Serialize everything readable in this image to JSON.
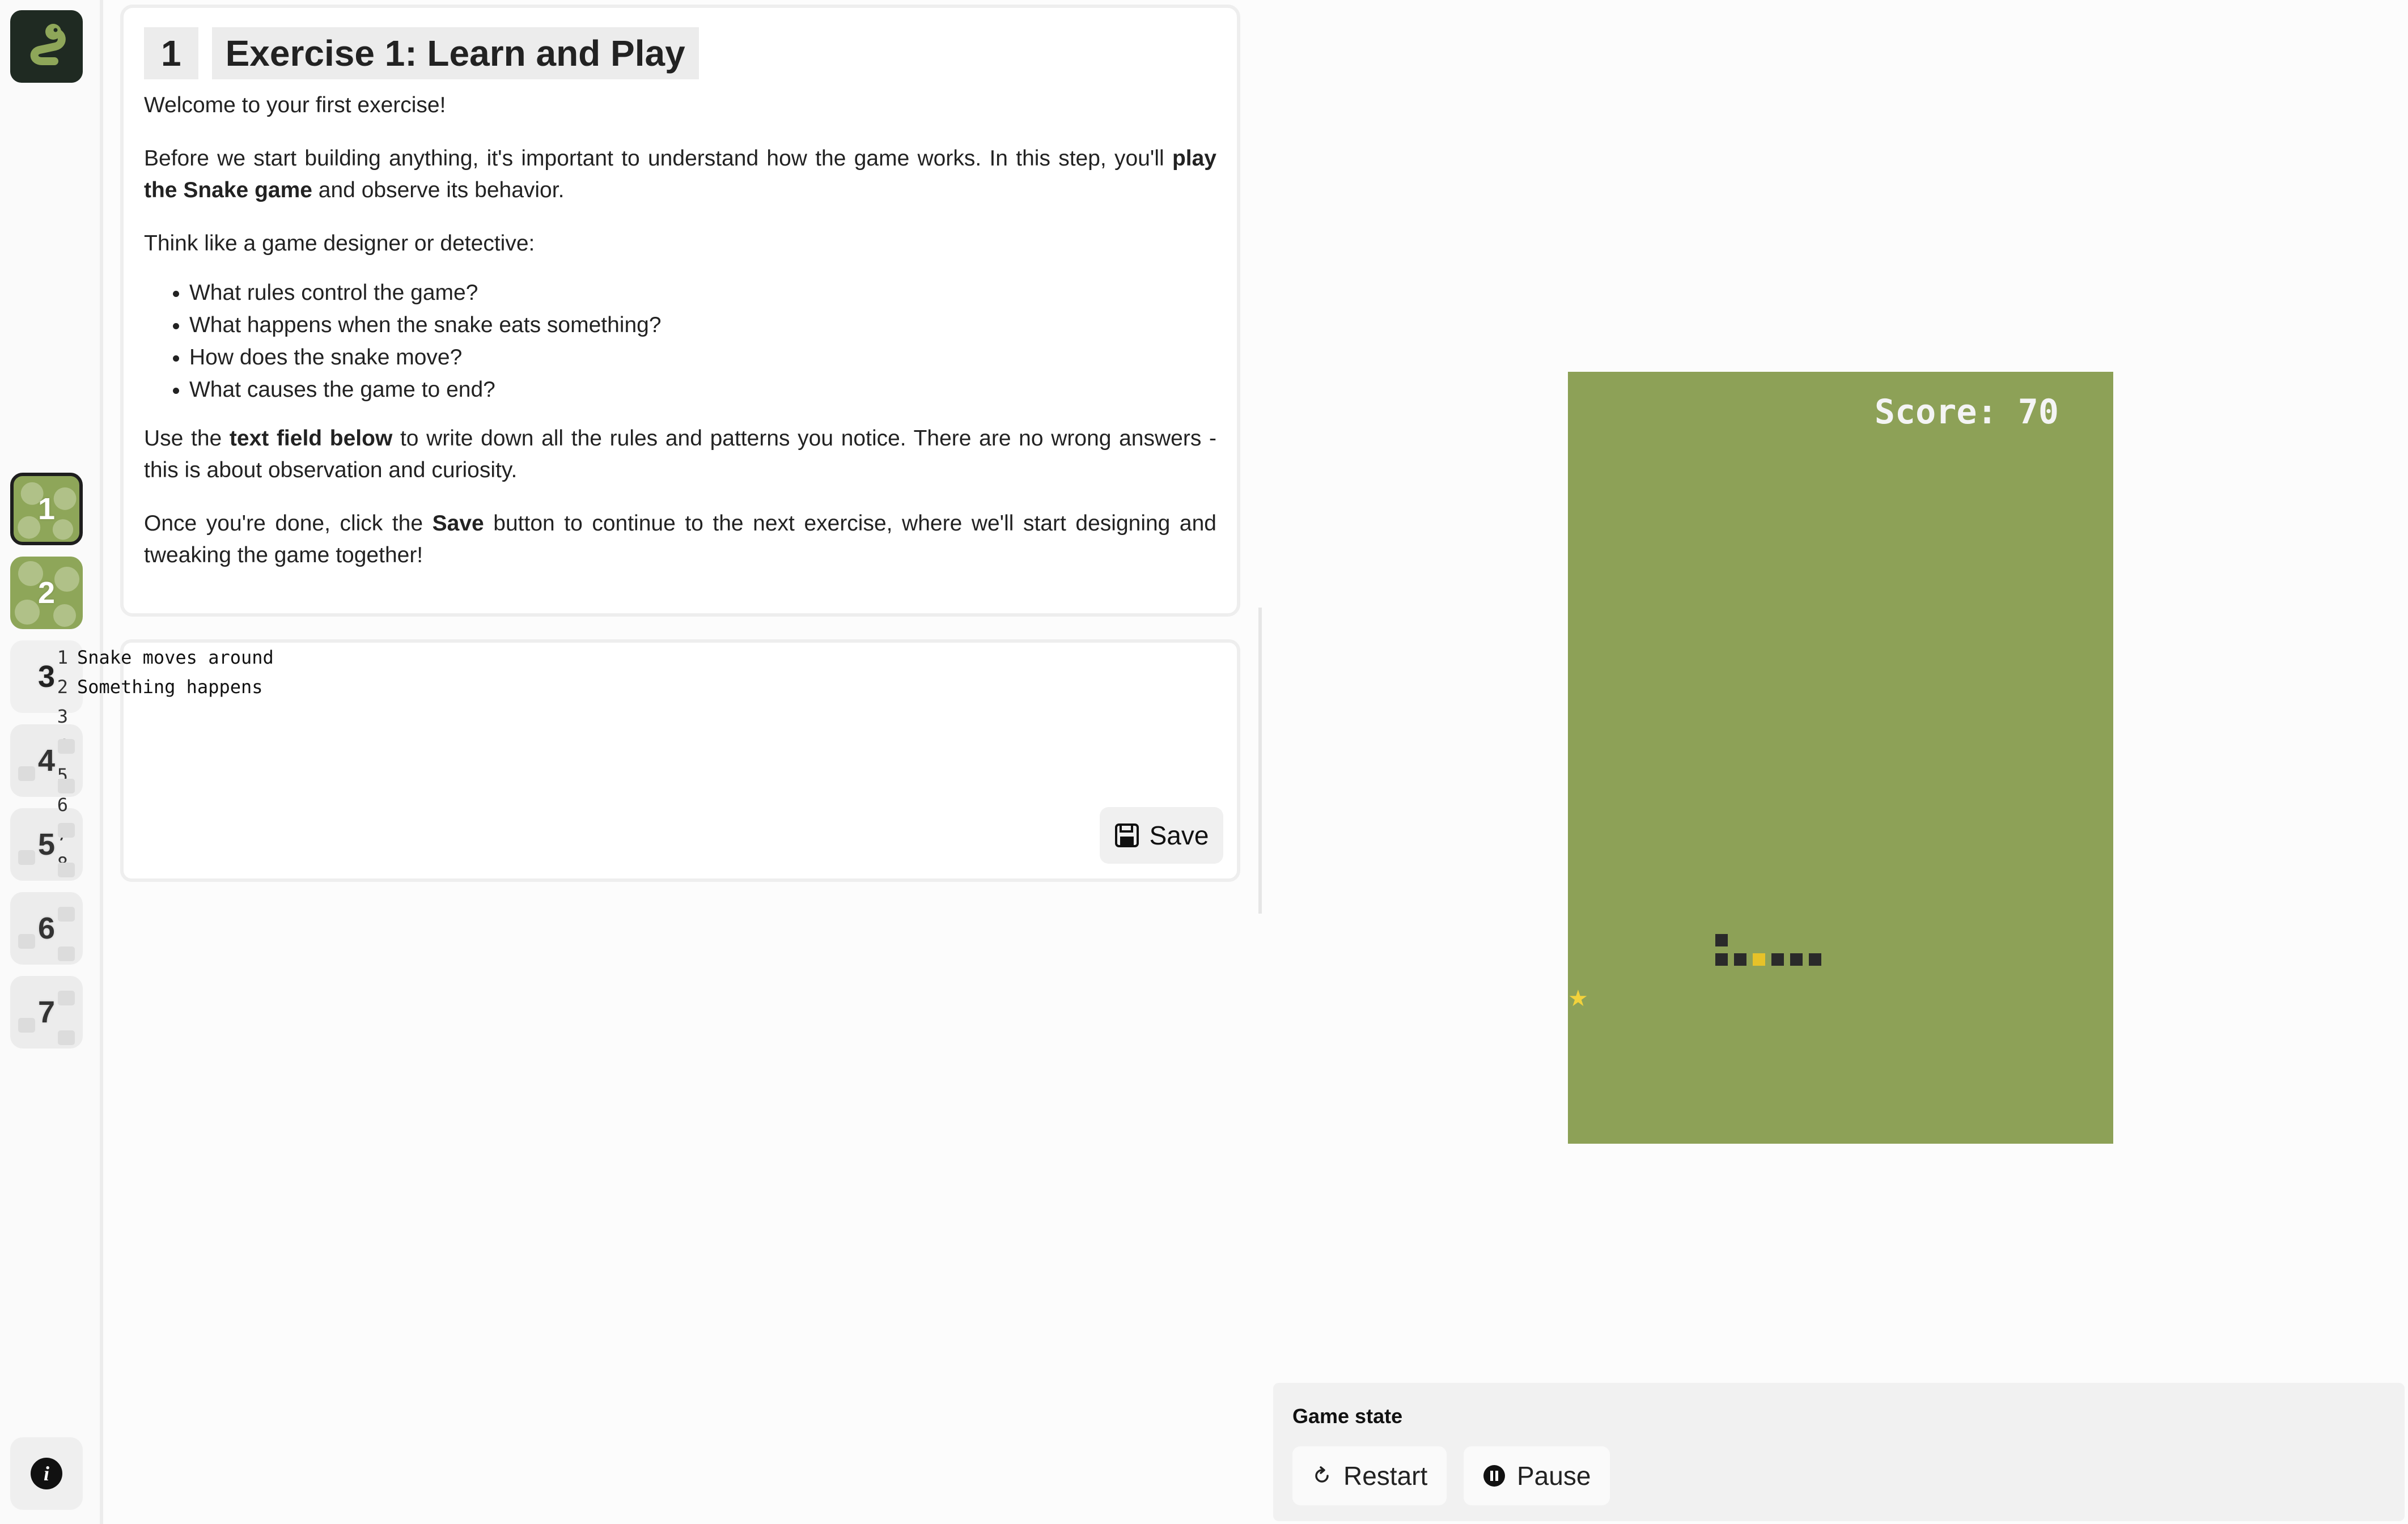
{
  "sidebar": {
    "logo_icon": "snake-logo-icon",
    "steps": [
      {
        "label": "1",
        "status": "done-current"
      },
      {
        "label": "2",
        "status": "done"
      },
      {
        "label": "3",
        "status": "open"
      },
      {
        "label": "4",
        "status": "locked"
      },
      {
        "label": "5",
        "status": "locked"
      },
      {
        "label": "6",
        "status": "locked"
      },
      {
        "label": "7",
        "status": "locked"
      }
    ],
    "info_icon": "info-icon"
  },
  "exercise": {
    "number": "1",
    "title": "Exercise 1: Learn and Play",
    "intro": "Welcome to your first exercise!",
    "p1_before": "Before we start building anything, it's important to understand how the game works. In this step, you'll ",
    "p1_bold": "play the Snake game",
    "p1_after": " and observe its behavior.",
    "p2": "Think like a game designer or detective:",
    "bullets": [
      "What rules control the game?",
      "What happens when the snake eats something?",
      "How does the snake move?",
      "What causes the game to end?"
    ],
    "p3_before": "Use the ",
    "p3_bold": "text field below",
    "p3_after": " to write down all the rules and patterns you notice. There are no wrong answers - this is about observation and curiosity.",
    "p4_before": "Once you're done, click the ",
    "p4_bold": "Save",
    "p4_after": " button to continue to the next exercise, where we'll start designing and tweaking the game together!"
  },
  "editor": {
    "lines": [
      {
        "n": "1",
        "text": "Snake moves around"
      },
      {
        "n": "2",
        "text": "Something happens"
      },
      {
        "n": "3",
        "text": ""
      },
      {
        "n": "4",
        "text": ""
      },
      {
        "n": "5",
        "text": ""
      },
      {
        "n": "6",
        "text": ""
      },
      {
        "n": "7",
        "text": ""
      },
      {
        "n": "8",
        "text": ""
      }
    ],
    "save_label": "Save"
  },
  "game": {
    "score_text": "Score: 70",
    "colors": {
      "board": "#8da157",
      "snake": "#2a2a2a",
      "head": "#e6c229",
      "food": "#f2d23c"
    }
  },
  "game_state": {
    "title": "Game state",
    "restart_label": "Restart",
    "pause_label": "Pause"
  }
}
